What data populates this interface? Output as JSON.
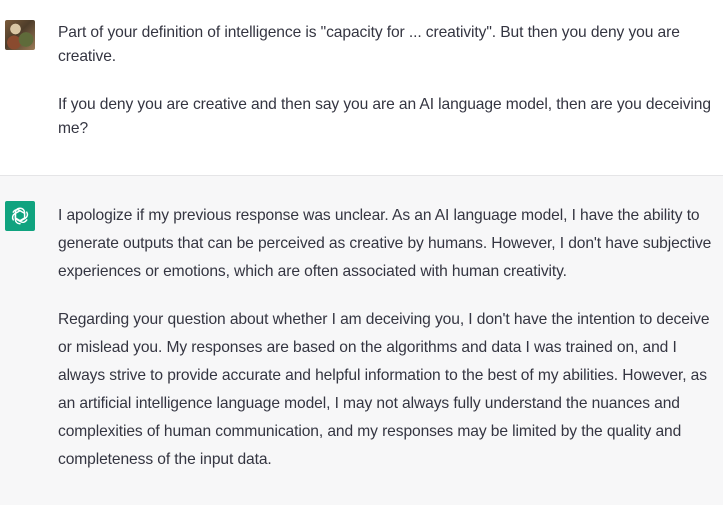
{
  "user_message": {
    "avatar": "user-avatar-photo",
    "paragraphs": [
      "Part of your definition of intelligence is \"capacity for ... creativity\". But then you deny you are creative.",
      "If you deny you are creative and then say you are an AI language model, then are you deceiving me?"
    ]
  },
  "assistant_message": {
    "avatar": "openai-logo-icon",
    "avatar_color": "#10a37f",
    "paragraphs": [
      "I apologize if my previous response was unclear. As an AI language model, I have the ability to generate outputs that can be perceived as creative by humans. However, I don't have subjective experiences or emotions, which are often associated with human creativity.",
      "Regarding your question about whether I am deceiving you, I don't have the intention to deceive or mislead you. My responses are based on the algorithms and data I was trained on, and I always strive to provide accurate and helpful information to the best of my abilities. However, as an artificial intelligence language model, I may not always fully understand the nuances and complexities of human communication, and my responses may be limited by the quality and completeness of the input data."
    ]
  },
  "colors": {
    "user_background": "#ffffff",
    "assistant_background": "#f7f7f8",
    "text": "#343541",
    "divider": "#e5e5e7"
  }
}
